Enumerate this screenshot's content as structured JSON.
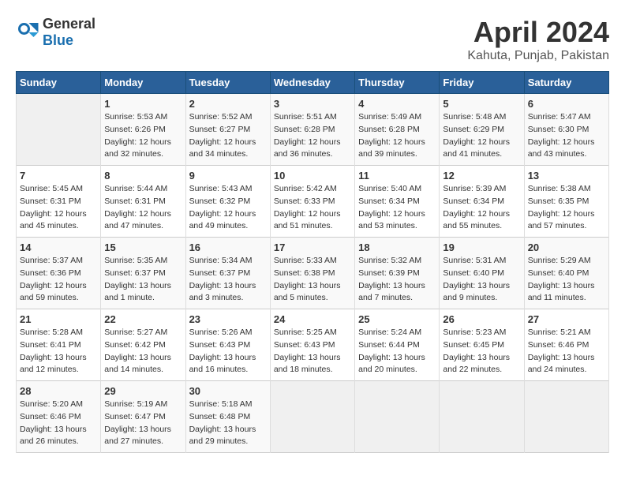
{
  "header": {
    "logo_general": "General",
    "logo_blue": "Blue",
    "title": "April 2024",
    "location": "Kahuta, Punjab, Pakistan"
  },
  "days_of_week": [
    "Sunday",
    "Monday",
    "Tuesday",
    "Wednesday",
    "Thursday",
    "Friday",
    "Saturday"
  ],
  "weeks": [
    [
      {
        "day": "",
        "sunrise": "",
        "sunset": "",
        "daylight": "",
        "empty": true
      },
      {
        "day": "1",
        "sunrise": "Sunrise: 5:53 AM",
        "sunset": "Sunset: 6:26 PM",
        "daylight": "Daylight: 12 hours and 32 minutes."
      },
      {
        "day": "2",
        "sunrise": "Sunrise: 5:52 AM",
        "sunset": "Sunset: 6:27 PM",
        "daylight": "Daylight: 12 hours and 34 minutes."
      },
      {
        "day": "3",
        "sunrise": "Sunrise: 5:51 AM",
        "sunset": "Sunset: 6:28 PM",
        "daylight": "Daylight: 12 hours and 36 minutes."
      },
      {
        "day": "4",
        "sunrise": "Sunrise: 5:49 AM",
        "sunset": "Sunset: 6:28 PM",
        "daylight": "Daylight: 12 hours and 39 minutes."
      },
      {
        "day": "5",
        "sunrise": "Sunrise: 5:48 AM",
        "sunset": "Sunset: 6:29 PM",
        "daylight": "Daylight: 12 hours and 41 minutes."
      },
      {
        "day": "6",
        "sunrise": "Sunrise: 5:47 AM",
        "sunset": "Sunset: 6:30 PM",
        "daylight": "Daylight: 12 hours and 43 minutes."
      }
    ],
    [
      {
        "day": "7",
        "sunrise": "Sunrise: 5:45 AM",
        "sunset": "Sunset: 6:31 PM",
        "daylight": "Daylight: 12 hours and 45 minutes."
      },
      {
        "day": "8",
        "sunrise": "Sunrise: 5:44 AM",
        "sunset": "Sunset: 6:31 PM",
        "daylight": "Daylight: 12 hours and 47 minutes."
      },
      {
        "day": "9",
        "sunrise": "Sunrise: 5:43 AM",
        "sunset": "Sunset: 6:32 PM",
        "daylight": "Daylight: 12 hours and 49 minutes."
      },
      {
        "day": "10",
        "sunrise": "Sunrise: 5:42 AM",
        "sunset": "Sunset: 6:33 PM",
        "daylight": "Daylight: 12 hours and 51 minutes."
      },
      {
        "day": "11",
        "sunrise": "Sunrise: 5:40 AM",
        "sunset": "Sunset: 6:34 PM",
        "daylight": "Daylight: 12 hours and 53 minutes."
      },
      {
        "day": "12",
        "sunrise": "Sunrise: 5:39 AM",
        "sunset": "Sunset: 6:34 PM",
        "daylight": "Daylight: 12 hours and 55 minutes."
      },
      {
        "day": "13",
        "sunrise": "Sunrise: 5:38 AM",
        "sunset": "Sunset: 6:35 PM",
        "daylight": "Daylight: 12 hours and 57 minutes."
      }
    ],
    [
      {
        "day": "14",
        "sunrise": "Sunrise: 5:37 AM",
        "sunset": "Sunset: 6:36 PM",
        "daylight": "Daylight: 12 hours and 59 minutes."
      },
      {
        "day": "15",
        "sunrise": "Sunrise: 5:35 AM",
        "sunset": "Sunset: 6:37 PM",
        "daylight": "Daylight: 13 hours and 1 minute."
      },
      {
        "day": "16",
        "sunrise": "Sunrise: 5:34 AM",
        "sunset": "Sunset: 6:37 PM",
        "daylight": "Daylight: 13 hours and 3 minutes."
      },
      {
        "day": "17",
        "sunrise": "Sunrise: 5:33 AM",
        "sunset": "Sunset: 6:38 PM",
        "daylight": "Daylight: 13 hours and 5 minutes."
      },
      {
        "day": "18",
        "sunrise": "Sunrise: 5:32 AM",
        "sunset": "Sunset: 6:39 PM",
        "daylight": "Daylight: 13 hours and 7 minutes."
      },
      {
        "day": "19",
        "sunrise": "Sunrise: 5:31 AM",
        "sunset": "Sunset: 6:40 PM",
        "daylight": "Daylight: 13 hours and 9 minutes."
      },
      {
        "day": "20",
        "sunrise": "Sunrise: 5:29 AM",
        "sunset": "Sunset: 6:40 PM",
        "daylight": "Daylight: 13 hours and 11 minutes."
      }
    ],
    [
      {
        "day": "21",
        "sunrise": "Sunrise: 5:28 AM",
        "sunset": "Sunset: 6:41 PM",
        "daylight": "Daylight: 13 hours and 12 minutes."
      },
      {
        "day": "22",
        "sunrise": "Sunrise: 5:27 AM",
        "sunset": "Sunset: 6:42 PM",
        "daylight": "Daylight: 13 hours and 14 minutes."
      },
      {
        "day": "23",
        "sunrise": "Sunrise: 5:26 AM",
        "sunset": "Sunset: 6:43 PM",
        "daylight": "Daylight: 13 hours and 16 minutes."
      },
      {
        "day": "24",
        "sunrise": "Sunrise: 5:25 AM",
        "sunset": "Sunset: 6:43 PM",
        "daylight": "Daylight: 13 hours and 18 minutes."
      },
      {
        "day": "25",
        "sunrise": "Sunrise: 5:24 AM",
        "sunset": "Sunset: 6:44 PM",
        "daylight": "Daylight: 13 hours and 20 minutes."
      },
      {
        "day": "26",
        "sunrise": "Sunrise: 5:23 AM",
        "sunset": "Sunset: 6:45 PM",
        "daylight": "Daylight: 13 hours and 22 minutes."
      },
      {
        "day": "27",
        "sunrise": "Sunrise: 5:21 AM",
        "sunset": "Sunset: 6:46 PM",
        "daylight": "Daylight: 13 hours and 24 minutes."
      }
    ],
    [
      {
        "day": "28",
        "sunrise": "Sunrise: 5:20 AM",
        "sunset": "Sunset: 6:46 PM",
        "daylight": "Daylight: 13 hours and 26 minutes."
      },
      {
        "day": "29",
        "sunrise": "Sunrise: 5:19 AM",
        "sunset": "Sunset: 6:47 PM",
        "daylight": "Daylight: 13 hours and 27 minutes."
      },
      {
        "day": "30",
        "sunrise": "Sunrise: 5:18 AM",
        "sunset": "Sunset: 6:48 PM",
        "daylight": "Daylight: 13 hours and 29 minutes."
      },
      {
        "day": "",
        "sunrise": "",
        "sunset": "",
        "daylight": "",
        "empty": true
      },
      {
        "day": "",
        "sunrise": "",
        "sunset": "",
        "daylight": "",
        "empty": true
      },
      {
        "day": "",
        "sunrise": "",
        "sunset": "",
        "daylight": "",
        "empty": true
      },
      {
        "day": "",
        "sunrise": "",
        "sunset": "",
        "daylight": "",
        "empty": true
      }
    ]
  ]
}
